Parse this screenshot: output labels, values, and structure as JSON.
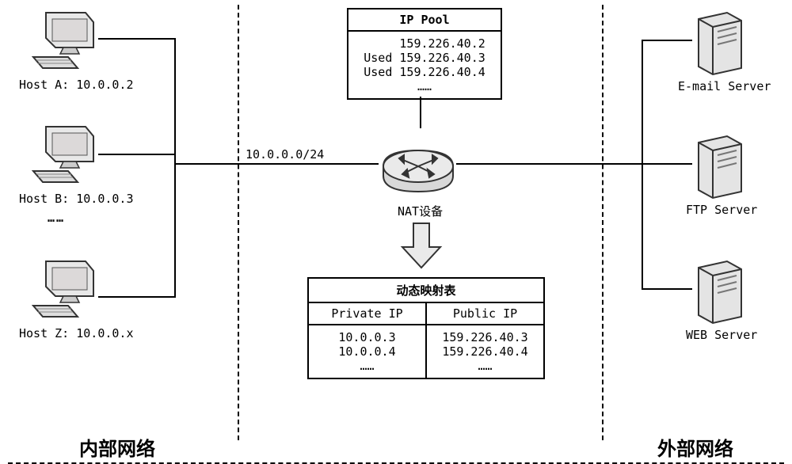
{
  "sections": {
    "internal": "内部网络",
    "external": "外部网络"
  },
  "hosts": {
    "a": "Host A: 10.0.0.2",
    "b": "Host B: 10.0.0.3",
    "z": "Host Z: 10.0.0.x",
    "dots": "……"
  },
  "subnet": "10.0.0.0/24",
  "ippool": {
    "title": "IP Pool",
    "rows": [
      "     159.226.40.2",
      "Used 159.226.40.3",
      "Used 159.226.40.4",
      "……"
    ]
  },
  "nat_label": "NAT设备",
  "maptable": {
    "title": "动态映射表",
    "hdr_private": "Private IP",
    "hdr_public": "Public IP",
    "private": [
      "10.0.0.3",
      "10.0.0.4",
      "……"
    ],
    "public": [
      "159.226.40.3",
      "159.226.40.4",
      "……"
    ]
  },
  "servers": {
    "mail": "E-mail Server",
    "ftp": "FTP Server",
    "web": "WEB Server"
  }
}
